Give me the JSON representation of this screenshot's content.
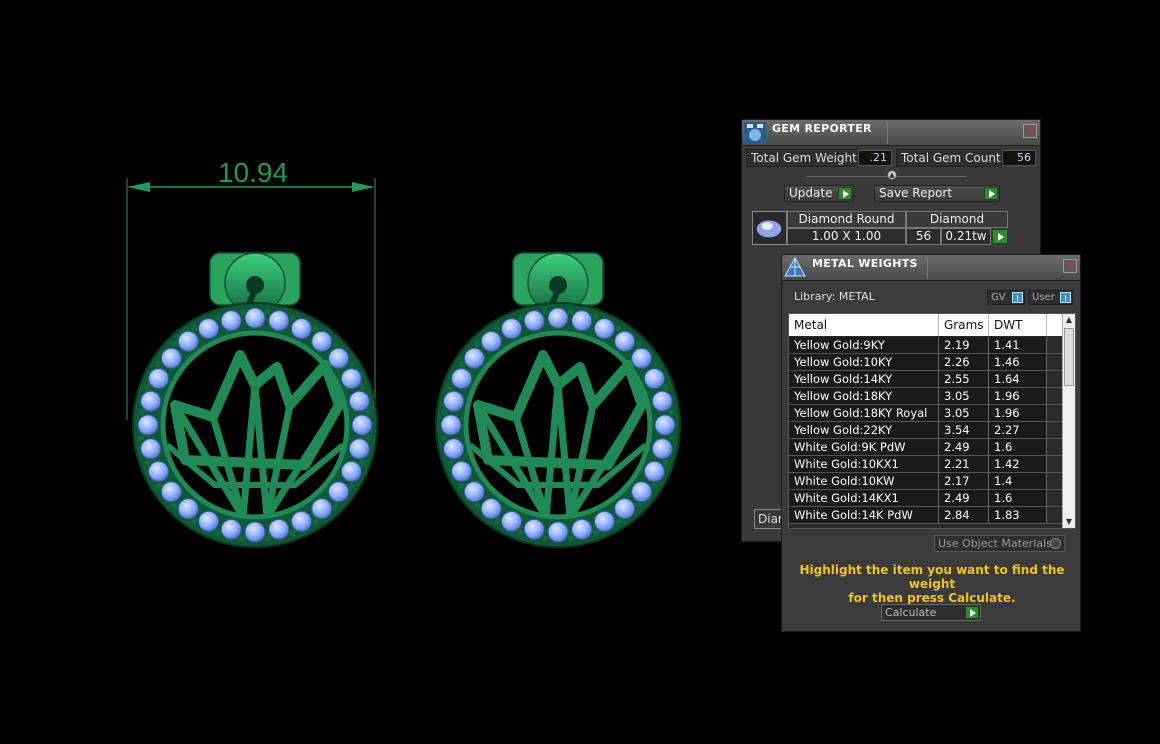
{
  "viewport": {
    "dimension_value": "10.94",
    "model_color": "#1f8a55",
    "gem_color": "#8fb0ff",
    "dimension_color": "#1f9a5a"
  },
  "gem_reporter": {
    "title": "GEM REPORTER",
    "total_gem_weight_label": "Total Gem Weight",
    "total_gem_weight_value": ".21",
    "total_gem_count_label": "Total Gem Count",
    "total_gem_count_value": "56",
    "update_label": "Update",
    "save_report_label": "Save Report",
    "gem_row": {
      "shape": "Diamond Round",
      "material": "Diamond",
      "size": "1.00 X 1.00",
      "count": "56",
      "weight": "0.21tw"
    },
    "partial_button_label": "Diam"
  },
  "metal_weights": {
    "title": "METAL WEIGHTS",
    "library_label": "Library: METAL",
    "gv_label": "GV",
    "user_label": "User",
    "columns": [
      "Metal",
      "Grams",
      "DWT"
    ],
    "rows": [
      [
        "Yellow Gold:9KY",
        "2.19",
        "1.41"
      ],
      [
        "Yellow Gold:10KY",
        "2.26",
        "1.46"
      ],
      [
        "Yellow Gold:14KY",
        "2.55",
        "1.64"
      ],
      [
        "Yellow Gold:18KY",
        "3.05",
        "1.96"
      ],
      [
        "Yellow Gold:18KY Royal",
        "3.05",
        "1.96"
      ],
      [
        "Yellow Gold:22KY",
        "3.54",
        "2.27"
      ],
      [
        "White Gold:9K PdW",
        "2.49",
        "1.6"
      ],
      [
        "White Gold:10KX1",
        "2.21",
        "1.42"
      ],
      [
        "White Gold:10KW",
        "2.17",
        "1.4"
      ],
      [
        "White Gold:14KX1",
        "2.49",
        "1.6"
      ],
      [
        "White Gold:14K PdW",
        "2.84",
        "1.83"
      ]
    ],
    "use_object_materials_label": "Use Object Materials",
    "hint_line1": "Highlight the item you want to find the weight",
    "hint_line2": "for then press Calculate.",
    "calculate_label": "Calculate"
  }
}
